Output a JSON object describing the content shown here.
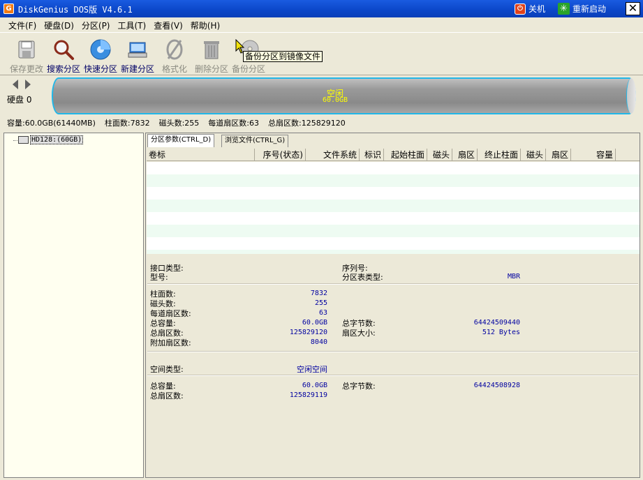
{
  "window": {
    "title": "DiskGenius DOS版 V4.6.1",
    "app_icon_letter": "G",
    "shutdown_label": "关机",
    "restart_label": "重新启动",
    "close_glyph": "✕"
  },
  "menu": [
    "文件(F)",
    "硬盘(D)",
    "分区(P)",
    "工具(T)",
    "查看(V)",
    "帮助(H)"
  ],
  "toolbar": {
    "save": "保存更改",
    "search": "搜索分区",
    "quick": "快速分区",
    "new": "新建分区",
    "format": "格式化",
    "delete": "删除分区",
    "backup": "备份分区",
    "tooltip": "备份分区到镜像文件"
  },
  "disk": {
    "label": "硬盘 0",
    "free_label": "空闲",
    "free_size": "60.0GB"
  },
  "info": {
    "capacity": "容量:60.0GB(61440MB)",
    "cylinders": "柱面数:7832",
    "heads": "磁头数:255",
    "sectors_per_track": "每道扇区数:63",
    "total_sectors": "总扇区数:125829120"
  },
  "tree": {
    "disk": "HD128:(60GB)"
  },
  "tabs": {
    "params": "分区参数(CTRL_D)",
    "browse": "浏览文件(CTRL_G)"
  },
  "columns": {
    "volume": "卷标",
    "index": "序号(状态)",
    "fs": "文件系统",
    "id": "标识",
    "start_cyl": "起始柱面",
    "start_head": "磁头",
    "start_sector": "扇区",
    "end_cyl": "终止柱面",
    "end_head": "磁头",
    "end_sector": "扇区",
    "capacity": "容量"
  },
  "details": {
    "interface_type_label": "接口类型:",
    "model_label": "型号:",
    "serial_label": "序列号:",
    "ptable_label": "分区表类型:",
    "ptable_value": "MBR",
    "cylinders_label": "柱面数:",
    "cylinders_value": "7832",
    "heads_label": "磁头数:",
    "heads_value": "255",
    "spt_label": "每道扇区数:",
    "spt_value": "63",
    "total_cap_label": "总容量:",
    "total_cap_value": "60.0GB",
    "total_bytes_label": "总字节数:",
    "total_bytes_value": "64424509440",
    "total_sectors_label": "总扇区数:",
    "total_sectors_value": "125829120",
    "sector_size_label": "扇区大小:",
    "sector_size_value": "512 Bytes",
    "extra_sectors_label": "附加扇区数:",
    "extra_sectors_value": "8040",
    "space_type_label": "空间类型:",
    "space_type_value": "空闲空间",
    "space_cap_label": "总容量:",
    "space_cap_value": "60.0GB",
    "space_bytes_label": "总字节数:",
    "space_bytes_value": "64424508928",
    "space_sectors_label": "总扇区数:",
    "space_sectors_value": "125829119"
  },
  "colors": {
    "title_bar": "#0b46c8",
    "disk_outline": "#21b7e8",
    "free_text": "#ffff00",
    "value_text": "#0000a0"
  }
}
